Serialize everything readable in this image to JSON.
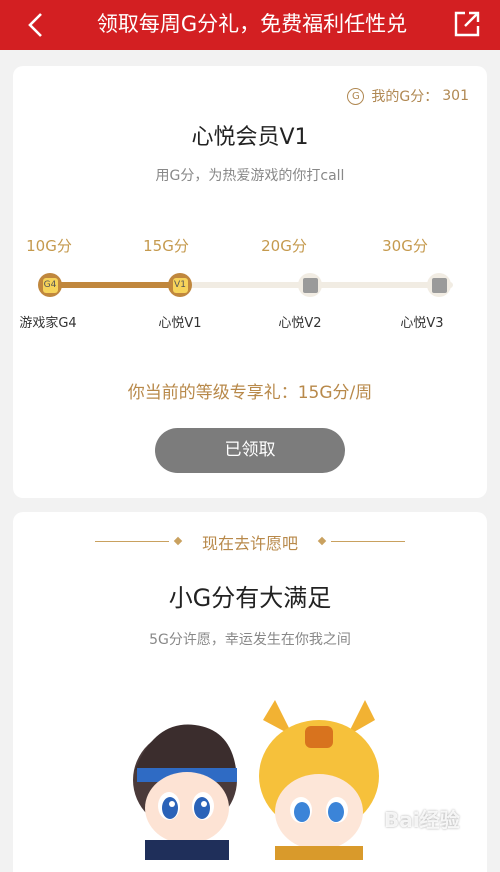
{
  "header": {
    "back_icon": "chevron-left-icon",
    "title": "领取每周G分礼，免费福利任性兑",
    "share_icon": "external-share-icon"
  },
  "membership": {
    "points_icon": "g-coin-icon",
    "points_label": "我的G分：",
    "points_value": "301",
    "level_name": "心悦会员V1",
    "slogan": "用G分，为热爱游戏的你打call",
    "tiers": [
      {
        "amount": "10G分",
        "name": "游戏家G4",
        "status": "achieved"
      },
      {
        "amount": "15G分",
        "name": "心悦V1",
        "status": "current"
      },
      {
        "amount": "20G分",
        "name": "心悦V2",
        "status": "locked"
      },
      {
        "amount": "30G分",
        "name": "心悦V3",
        "status": "locked"
      }
    ],
    "progress_fraction": 0.34,
    "current_gift": "你当前的等级专享礼：15G分/周",
    "claim_button": "已领取"
  },
  "wish": {
    "section_title": "现在去许愿吧",
    "headline": "小G分有大满足",
    "subtitle": "5G分许愿，幸运发生在你我之间",
    "illustration": "two-chibi-game-characters"
  },
  "watermark": "Bai经验",
  "colors": {
    "header_red": "#d31f22",
    "gold": "#c0873d",
    "gold_text": "#b8894a",
    "button_gray": "#7c7c7c"
  }
}
